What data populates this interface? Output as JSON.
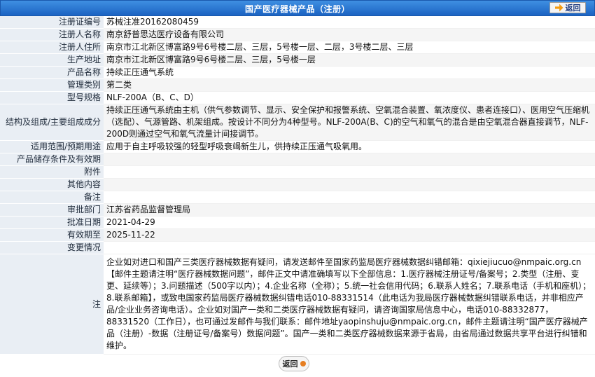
{
  "header": {
    "title": "国产医疗器械产品（注册）",
    "back_label": "返回"
  },
  "rows": [
    {
      "label": "注册证编号",
      "value": "苏械注准20162080459"
    },
    {
      "label": "注册人名称",
      "value": "南京舒普思达医疗设备有限公司"
    },
    {
      "label": "注册人住所",
      "value": "南京市江北新区博富路9号6号楼二层、三层，5号楼一层、二层，3号楼二层、三层"
    },
    {
      "label": "生产地址",
      "value": "南京市江北新区博富路9号6号楼二层、三层，5号楼一层"
    },
    {
      "label": "产品名称",
      "value": "持续正压通气系统"
    },
    {
      "label": "管理类别",
      "value": "第二类"
    },
    {
      "label": "型号规格",
      "value": "NLF-200A（B、C、D）"
    },
    {
      "label": "结构及组成/主要组成成分",
      "value": "持续正压通气系统由主机（供气参数调节、显示、安全保护和报警系统、空氧混合装置、氧浓度仪、患者连接口）、医用空气压缩机（选配）、气源管路、机架组成。按设计不同分为4种型号。NLF-200A(B、C)的空气和氧气的混合是由空氧混合器直接调节，NLF-200D则通过空气和氧气流量计间接调节。"
    },
    {
      "label": "适用范围/预期用途",
      "value": "应用于自主呼吸较强的轻型呼吸衰竭新生儿，供持续正压通气吸氧用。"
    },
    {
      "label": "产品储存条件及有效期",
      "value": ""
    },
    {
      "label": "附件",
      "value": ""
    },
    {
      "label": "其他内容",
      "value": ""
    },
    {
      "label": "备注",
      "value": ""
    },
    {
      "label": "审批部门",
      "value": "江苏省药品监督管理局"
    },
    {
      "label": "批准日期",
      "value": "2021-04-29"
    },
    {
      "label": "有效期至",
      "value": "2025-11-22"
    },
    {
      "label": "变更情况",
      "value": ""
    }
  ],
  "notes": {
    "label": "注",
    "text": "企业如对进口和国产三类医疗器械数据有疑问，请发送邮件至国家药监局医疗器械数据纠错邮箱：qixiejiucuo@nmpaic.org.cn【邮件主题请注明“医疗器械数据问题”，邮件正文中请准确填写以下全部信息：1.医疗器械注册证号/备案号；2.类型（注册、变更、延续等）；3.问题描述（500字以内）；4.企业名称（全称）；5.统一社会信用代码；6.联系人姓名；7.联系电话（手机和座机）；8.联系邮箱】，或致电国家药监局医疗器械数据纠错电话010-88331514（此电话为我局医疗器械数据纠错联系电话，并非相应产品/企业业务咨询电话）。企业如对国产一类和二类医疗器械数据有疑问，请咨询国家局信息中心，电话010-88332877，88331520（工作日），也可通过发邮件与我们联系：邮件地址yaopinshuju@nmpaic.org.cn，邮件主题请注明“国产医疗器械产品（注册）-数据（注册证号/备案号）数据问题”。国产一类和二类医疗器械数据来源于省局，由省局通过数据共享平台进行纠错和维护。"
  },
  "footer": {
    "back_label": "返回"
  }
}
